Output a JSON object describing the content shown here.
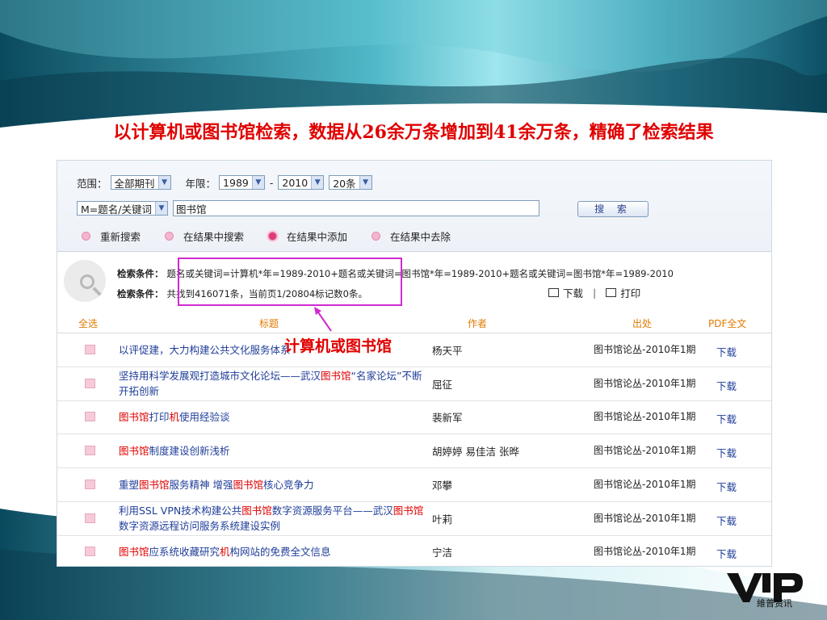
{
  "slide_title": "以计算机或图书馆检索，数据从26余万条增加到41余万条，精确了检索结果",
  "search": {
    "scope_label": "范围：",
    "scope_value": "全部期刊",
    "years_label": "年限：",
    "year_from": "1989",
    "year_dash": "-",
    "year_to": "2010",
    "page_size": "20条",
    "field_value": "M=题名/关键词",
    "keyword_value": "图书馆",
    "search_button": "搜 索",
    "radios": [
      {
        "label": "重新搜索",
        "selected": false
      },
      {
        "label": "在结果中搜索",
        "selected": false
      },
      {
        "label": "在结果中添加",
        "selected": true
      },
      {
        "label": "在结果中去除",
        "selected": false
      }
    ]
  },
  "conditions": {
    "label1": "检索条件：",
    "line1": "题名或关键词=计算机*年=1989-2010+题名或关键词=图书馆*年=1989-2010+题名或关键词=图书馆*年=1989-2010",
    "label2": "检索条件：",
    "line2": "共找到416071条，当前页1/20804标记数0条。",
    "download": "下载",
    "separator": "|",
    "print": "打印"
  },
  "table": {
    "headers": {
      "select_all": "全选",
      "title": "标题",
      "author": "作者",
      "source": "出处",
      "pdf": "PDF全文"
    },
    "rows": [
      {
        "title": [
          {
            "t": "以评促建，大力构建公共文化服务体系",
            "hl": false
          }
        ],
        "author": "杨天平",
        "source": "图书馆论丛-2010年1期",
        "dl": "下载"
      },
      {
        "title": [
          {
            "t": "坚持用科学发展观打造城市文化论坛——武汉",
            "hl": false
          },
          {
            "t": "图书馆",
            "hl": true
          },
          {
            "t": "“名家论坛”不断开拓创新",
            "hl": false
          }
        ],
        "author": "屈征",
        "source": "图书馆论丛-2010年1期",
        "dl": "下载"
      },
      {
        "title": [
          {
            "t": "图书馆",
            "hl": true
          },
          {
            "t": "打印",
            "hl": false
          },
          {
            "t": "机",
            "hl": true
          },
          {
            "t": "使用经验谈",
            "hl": false
          }
        ],
        "author": "裴新军",
        "source": "图书馆论丛-2010年1期",
        "dl": "下载"
      },
      {
        "title": [
          {
            "t": "图书馆",
            "hl": true
          },
          {
            "t": "制度建设创新浅析",
            "hl": false
          }
        ],
        "author": "胡婷婷 易佳洁 张晔",
        "source": "图书馆论丛-2010年1期",
        "dl": "下载"
      },
      {
        "title": [
          {
            "t": "重塑",
            "hl": false
          },
          {
            "t": "图书馆",
            "hl": true
          },
          {
            "t": "服务精神 增强",
            "hl": false
          },
          {
            "t": "图书馆",
            "hl": true
          },
          {
            "t": "核心竞争力",
            "hl": false
          }
        ],
        "author": "邓攀",
        "source": "图书馆论丛-2010年1期",
        "dl": "下载"
      },
      {
        "title": [
          {
            "t": "利用SSL VPN技术构建公共",
            "hl": false
          },
          {
            "t": "图书馆",
            "hl": true
          },
          {
            "t": "数字资源服务平台——武汉",
            "hl": false
          },
          {
            "t": "图书馆",
            "hl": true
          },
          {
            "t": "数字资源远程访问服务系统建设实例",
            "hl": false
          }
        ],
        "author": "叶莉",
        "source": "图书馆论丛-2010年1期",
        "dl": "下载"
      },
      {
        "title": [
          {
            "t": "图书馆",
            "hl": true
          },
          {
            "t": "应系统收藏研究",
            "hl": false
          },
          {
            "t": "机",
            "hl": true
          },
          {
            "t": "构网站的免费全文信息",
            "hl": false
          }
        ],
        "author": "宁洁",
        "source": "图书馆论丛-2010年1期",
        "dl": "下载"
      }
    ]
  },
  "annotation": "计算机或图书馆",
  "logo": {
    "mark": "VIP",
    "text": "維普资讯"
  },
  "colors": {
    "title_red": "#e00000",
    "link_blue": "#1f3d99",
    "header_orange": "#e07a00",
    "highlight_magenta": "#d02ad0",
    "teal_dark": "#0d4f63"
  }
}
